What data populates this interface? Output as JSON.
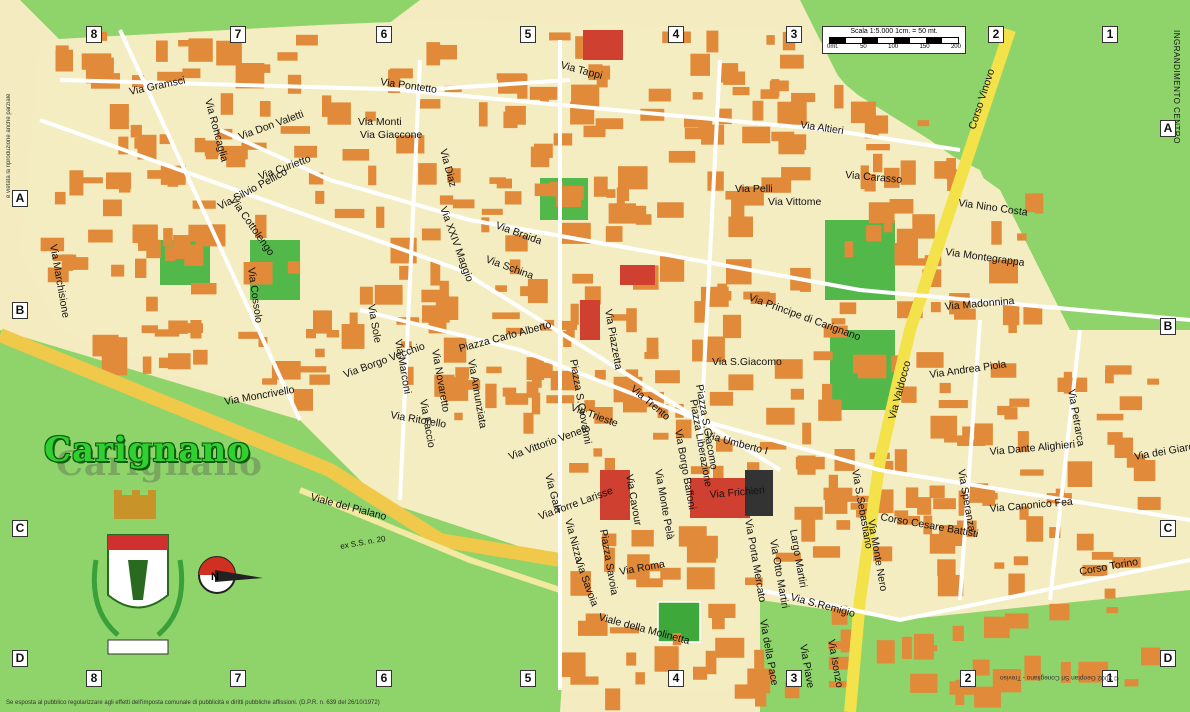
{
  "title": "Carignano",
  "scale": {
    "line1": "Scala 1:5.000   1cm. = 50 mt.",
    "ticks": [
      "0mt.",
      "50",
      "100",
      "150",
      "200"
    ]
  },
  "side_note": "INGRANDIMENTO CENTRO",
  "left_note": "è vietata la riproduzione anche parziale",
  "footer": "Se esposta al pubblico regolarizzare agli effetti dell'imposta comunale di pubblicità e diritti pubbliche affissioni. (D.P.R. n. 639 del 26/10/1972)",
  "copyright": "© 2002 Geoplan Srl   Conegliano - Treviso",
  "road_label": "ex S.S. n. 20",
  "grid": {
    "columns_top": [
      "8",
      "7",
      "6",
      "5",
      "4",
      "3",
      "2",
      "1"
    ],
    "columns_bottom": [
      "8",
      "7",
      "6",
      "5",
      "4",
      "3",
      "2",
      "1"
    ],
    "rows_left": [
      "A",
      "B",
      "C",
      "D"
    ],
    "rows_right": [
      "A",
      "B",
      "C",
      "D"
    ]
  },
  "streets": [
    "Via Pontetto",
    "Via Tappi",
    "Via Altieri",
    "Via Carasso",
    "Via Nino Costa",
    "Via Montegrappa",
    "Via Madonnina",
    "Via Andrea Piola",
    "Via Dante Alighieri",
    "Via Canonico Fea",
    "Via dei Giardini",
    "Corso Torino",
    "Corso Cesare Battisti",
    "Via S.Remigio",
    "Via Monte Nero",
    "Via Valdocco",
    "Via S.Sebastiano",
    "Via Speranza",
    "Via Petrarca",
    "Corso Vinovo",
    "Via Principe di Carignano",
    "Via Vittome",
    "Via Pelli",
    "Via Umberto I",
    "Via Frichieri",
    "Via Roma",
    "Via Piave",
    "Via Isonzo",
    "Via della Pace",
    "Viale della Molinetta",
    "Via Savoia",
    "Via Trento",
    "Via Trieste",
    "Piazza Carlo Alberto",
    "Via Vittorio Veneto",
    "Via Borgo Vecchio",
    "Via Moncrivello",
    "Viale del Pialano",
    "Via Silvio Pellico",
    "Via Braida",
    "Via Schina",
    "Via Giaccone",
    "Via Curietto",
    "Via Don Valetti",
    "Via Cottolengo",
    "Via Cossolo",
    "Via Marchisione",
    "Via Monti",
    "Via Gramsci",
    "Via Roncaglia",
    "Via XXIV Maggio",
    "Via Diaz",
    "Via Sole",
    "Via Marconi",
    "Via Novaretto",
    "Via Annunziata",
    "Via Faccio",
    "Piazza Liberazione",
    "Piazza S.Giovanni",
    "Via S.Giacomo",
    "Piazza S.Giacomo",
    "Via Cavour",
    "Piazza Savoia",
    "Via Torre Larisse",
    "Via Gaia",
    "Via Piazzetta",
    "Via Ritorello",
    "Largo Martiri",
    "Via Otto Martiri",
    "Via Porta Mercato",
    "Via Monte Pelà",
    "Via Borgo Baffoni",
    "Via Nizza"
  ],
  "colors": {
    "background": "#f4ecc0",
    "green": "#8fd46a",
    "building": "#e08a3a",
    "major_road": "#f3e24a",
    "red_block": "#d04030"
  }
}
